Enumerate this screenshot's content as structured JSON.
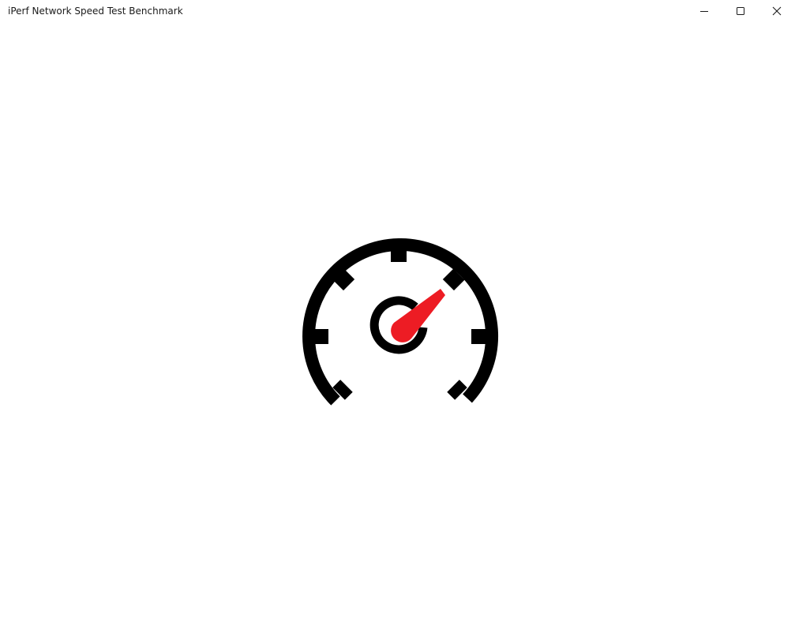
{
  "window": {
    "title": "iPerf Network Speed Test Benchmark"
  },
  "title_bar": {
    "controls": [
      "minimize",
      "maximize",
      "close"
    ]
  },
  "splash": {
    "icon": "speedometer-icon",
    "colors": {
      "dial": "#000000",
      "needle": "#ED1C24",
      "background": "#ffffff"
    }
  }
}
